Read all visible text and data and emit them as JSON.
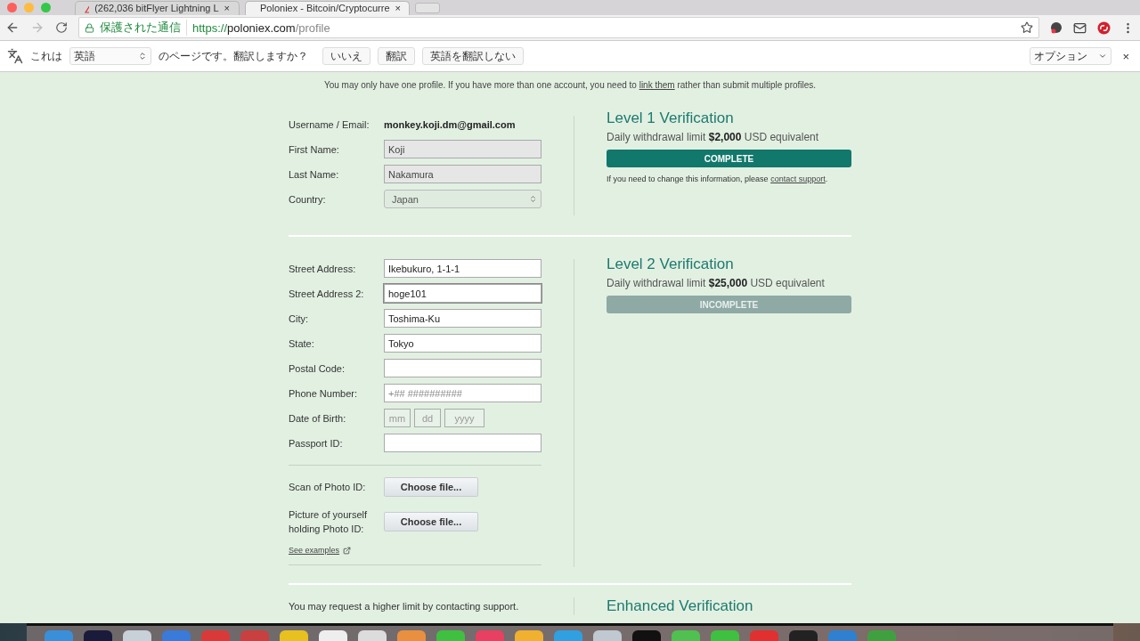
{
  "browser": {
    "tabs": [
      {
        "title": "(262,036 bitFlyer Lightning L",
        "close": "×",
        "selected": false
      },
      {
        "title": "Poloniex - Bitcoin/Cryptocurre",
        "close": "×",
        "selected": true
      }
    ],
    "address_bar": {
      "secure_label": "保護された通信",
      "url_scheme": "https://",
      "url_host": "poloniex.com",
      "url_path": "/profile"
    },
    "translate_bar": {
      "prefix": "これは",
      "language": "英語",
      "suffix": "のページです。翻訳しますか？",
      "buttons": [
        "いいえ",
        "翻訳",
        "英語を翻訳しない"
      ],
      "options": "オプション",
      "close": "×"
    }
  },
  "notice": {
    "before": "You may only have one profile. If you have more than one account, you need to",
    "link": "link them",
    "after": "rather than submit multiple profiles."
  },
  "level1": {
    "fields": [
      {
        "kind": "static",
        "label": "Username / Email:",
        "value": "monkey.koji.dm@gmail.com"
      },
      {
        "kind": "readonly",
        "label": "First Name:",
        "value": "Koji"
      },
      {
        "kind": "readonly",
        "label": "Last Name:",
        "value": "Nakamura"
      },
      {
        "kind": "select",
        "label": "Country:",
        "value": "Japan"
      }
    ],
    "title": "Level 1 Verification",
    "limit": "Daily withdrawal limit **$2,000** USD equivalent",
    "status": {
      "label": "COMPLETE",
      "complete": true
    },
    "note_before": "If you need to change this information, please",
    "note_link": "contact support",
    "note_after": "."
  },
  "level2": {
    "fields": [
      {
        "kind": "text",
        "label": "Street Address:",
        "value": "Ikebukuro, 1-1-1"
      },
      {
        "kind": "text",
        "label": "Street Address 2:",
        "value": "hoge101",
        "focused": true
      },
      {
        "kind": "text",
        "label": "City:",
        "value": "Toshima-Ku"
      },
      {
        "kind": "text",
        "label": "State:",
        "value": "Tokyo"
      },
      {
        "kind": "text",
        "label": "Postal Code:"
      },
      {
        "kind": "text",
        "label": "Phone Number:",
        "placeholder": "+## ##########"
      },
      {
        "kind": "date",
        "label": "Date of Birth:",
        "placeholders": [
          "mm",
          "dd",
          "yyyy"
        ]
      },
      {
        "kind": "text",
        "label": "Passport ID:"
      }
    ],
    "files": [
      {
        "label": "Scan of Photo ID:",
        "button": "Choose file..."
      },
      {
        "label": "Picture of yourself holding Photo ID:",
        "button": "Choose file..."
      }
    ],
    "examples_link": "See examples",
    "title": "Level 2 Verification",
    "limit": "Daily withdrawal limit **$25,000** USD equivalent",
    "status": {
      "label": "INCOMPLETE",
      "complete": false
    }
  },
  "enhanced": {
    "text": "You may request a higher limit by contacting support.",
    "title": "Enhanced Verification"
  }
}
